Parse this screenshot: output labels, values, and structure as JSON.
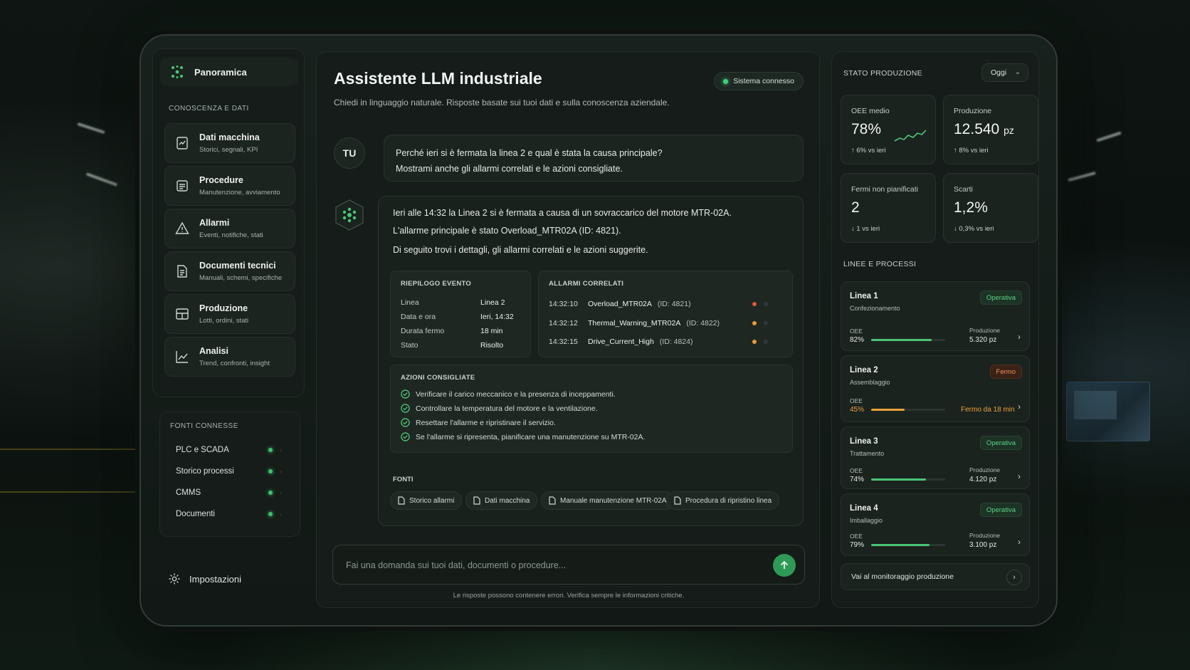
{
  "sidebar": {
    "overview_label": "Panoramica",
    "section_title": "CONOSCENZA E DATI",
    "items": [
      {
        "label": "Dati macchina",
        "desc": "Storici, segnali, KPI",
        "icon": "machine-data-icon"
      },
      {
        "label": "Procedure",
        "desc": "Manutenzione, avviamento",
        "icon": "procedure-icon"
      },
      {
        "label": "Allarmi",
        "desc": "Eventi, notifiche, stati",
        "icon": "alarm-icon"
      },
      {
        "label": "Documenti tecnici",
        "desc": "Manuali, schemi, specifiche",
        "icon": "document-icon"
      },
      {
        "label": "Produzione",
        "desc": "Lotti, ordini, stati",
        "icon": "production-icon"
      },
      {
        "label": "Analisi",
        "desc": "Trend, confronti, insight",
        "icon": "analytics-icon"
      }
    ],
    "sources_title": "FONTI CONNESSE",
    "sources": [
      "PLC e SCADA",
      "Storico processi",
      "CMMS",
      "Documenti"
    ],
    "settings_label": "Impostazioni"
  },
  "chat": {
    "title": "Assistente LLM industriale",
    "subtitle": "Chiedi in linguaggio naturale. Risposte basate sui tuoi dati e sulla conoscenza aziendale.",
    "status": "Sistema connesso",
    "user_avatar": "TU",
    "user_message": [
      "Perché ieri si è fermata la linea 2 e qual è stata la causa principale?",
      "Mostrami anche gli allarmi correlati e le azioni consigliate."
    ],
    "response": [
      "Ieri alle 14:32 la Linea 2 si è fermata a causa di un sovraccarico del motore MTR-02A.",
      "L'allarme principale è stato Overload_MTR02A (ID: 4821).",
      "Di seguito trovi i dettagli, gli allarmi correlati e le azioni suggerite."
    ],
    "summary": {
      "title": "RIEPILOGO EVENTO",
      "rows": [
        {
          "k": "Linea",
          "v": "Linea 2"
        },
        {
          "k": "Data e ora",
          "v": "Ieri, 14:32"
        },
        {
          "k": "Durata fermo",
          "v": "18 min"
        },
        {
          "k": "Stato",
          "v": "Risolto"
        }
      ]
    },
    "alarms": {
      "title": "ALLARMI CORRELATI",
      "rows": [
        {
          "time": "14:32:10",
          "name": "Overload_MTR02A",
          "id": "(ID: 4821)",
          "color": "#e0563a"
        },
        {
          "time": "14:32:12",
          "name": "Thermal_Warning_MTR02A",
          "id": "(ID: 4822)",
          "color": "#e89a35"
        },
        {
          "time": "14:32:15",
          "name": "Drive_Current_High",
          "id": "(ID: 4824)",
          "color": "#e89a35"
        }
      ]
    },
    "actions": {
      "title": "AZIONI CONSIGLIATE",
      "items": [
        "Verificare il carico meccanico e la presenza di inceppamenti.",
        "Controllare la temperatura del motore e la ventilazione.",
        "Resettare l'allarme e ripristinare il servizio.",
        "Se l'allarme si ripresenta, pianificare una manutenzione su MTR-02A."
      ]
    },
    "sources_title": "FONTI",
    "sources": [
      "Storico allarmi",
      "Dati macchina",
      "Manuale manutenzione MTR-02A",
      "Procedura di ripristino linea"
    ],
    "input_placeholder": "Fai una domanda sui tuoi dati, documenti o procedure...",
    "disclaimer": "Le risposte possono contenere errori. Verifica sempre le informazioni critiche."
  },
  "production": {
    "title": "STATO PRODUZIONE",
    "period": "Oggi",
    "kpis": [
      {
        "label": "OEE medio",
        "value": "78%",
        "unit": "",
        "change": "↑ 6% vs ieri"
      },
      {
        "label": "Produzione",
        "value": "12.540",
        "unit": "pz",
        "change": "↑ 8% vs ieri"
      },
      {
        "label": "Fermi non pianificati",
        "value": "2",
        "unit": "",
        "change": "↓ 1 vs ieri"
      },
      {
        "label": "Scarti",
        "value": "1,2%",
        "unit": "",
        "change": "↓ 0,3% vs ieri"
      }
    ],
    "lines_title": "LINEE E PROCESSI",
    "oee_label": "OEE",
    "prod_label": "Produzione",
    "lines": [
      {
        "name": "Linea 1",
        "process": "Confezionamento",
        "status": "Operativa",
        "oee": "82%",
        "oee_frac": 0.82,
        "production": "5.320 pz"
      },
      {
        "name": "Linea 2",
        "process": "Assemblaggio",
        "status": "Fermo",
        "oee": "45%",
        "oee_frac": 0.45,
        "production": "Fermo da 18 min"
      },
      {
        "name": "Linea 3",
        "process": "Trattamento",
        "status": "Operativa",
        "oee": "74%",
        "oee_frac": 0.74,
        "production": "4.120 pz"
      },
      {
        "name": "Linea 4",
        "process": "Imballaggio",
        "status": "Operativa",
        "oee": "79%",
        "oee_frac": 0.79,
        "production": "3.100 pz"
      }
    ],
    "monitor_link": "Vai al monitoraggio produzione"
  },
  "colors": {
    "accent": "#3fbf6c",
    "ok": "#5fd087",
    "stop": "#f0935c",
    "bar_ok": "#4cc577",
    "bar_stop": "#e9a23c"
  }
}
